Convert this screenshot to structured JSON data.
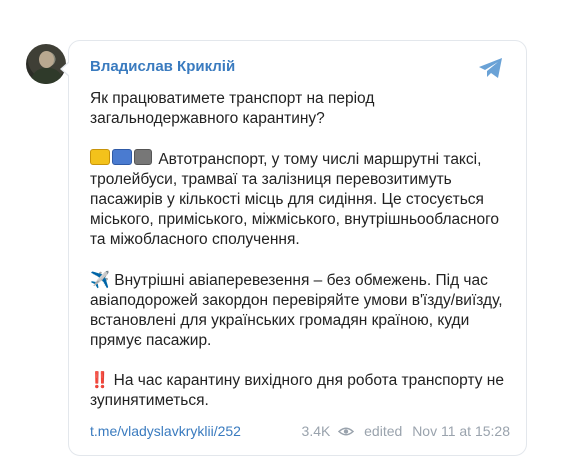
{
  "post": {
    "author": "Владислав Криклій",
    "paragraphs": {
      "p1": "Як працюватимете транспорт на період загальнодержавного карантину?",
      "p2": "Автотранспорт, у тому числі маршрутні таксі, тролейбуси, трамваї та залізниця перевозитимуть пасажирів у кількості місць для сидіння. Це стосується міського, приміського, міжміського, внутрішньообласного та міжобласного сполучення.",
      "p3": "Внутрішні авіаперевезення – без обмежень. Під час авіаподорожей закордон перевіряйте умови в'їзду/виїзду, встановлені для українських громадян країною, куди прямує пасажир.",
      "p4": "На час карантину вихідного дня робота транспорту не зупинятиметься."
    },
    "emojis": {
      "plane": "✈️",
      "double_exclamation": "‼️"
    },
    "link": "t.me/vladyslavkryklii/252",
    "views": "3.4K",
    "edited_label": "edited",
    "timestamp": "Nov 11 at 15:28"
  },
  "colors": {
    "accent": "#3a7bbf",
    "meta": "#9aa3ad"
  },
  "icons": [
    "avatar",
    "telegram-plane-icon",
    "bus-icons",
    "plane-emoji-icon",
    "double-exclamation-icon",
    "eye-icon"
  ]
}
